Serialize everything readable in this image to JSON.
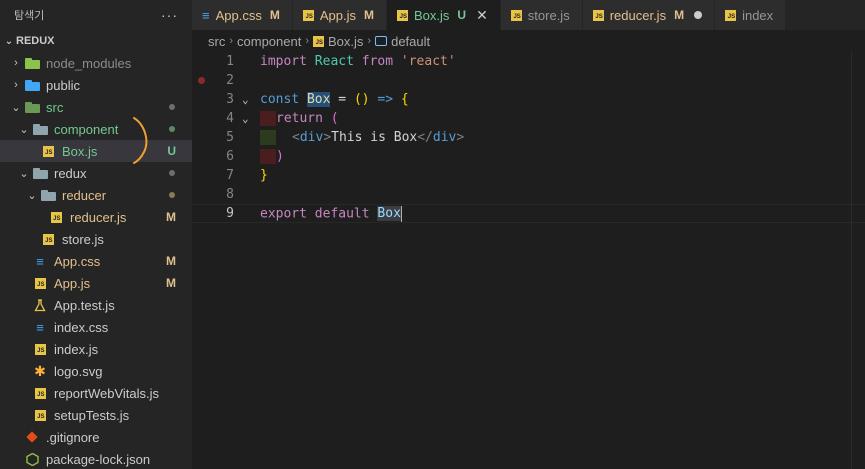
{
  "sidebar": {
    "title": "탐색기",
    "more_label": "···",
    "workspace": "REDUX",
    "items": [
      {
        "label": "node_modules",
        "depth": 1,
        "kind": "folder",
        "icon": "node-modules-folder-icon",
        "chev": "›",
        "status": "",
        "color": "dim"
      },
      {
        "label": "public",
        "depth": 1,
        "kind": "folder",
        "icon": "public-folder-icon",
        "chev": "›",
        "status": "",
        "color": ""
      },
      {
        "label": "src",
        "depth": 1,
        "kind": "folder-open",
        "icon": "src-folder-icon",
        "chev": "⌄",
        "status": "dot",
        "color": "untracked"
      },
      {
        "label": "component",
        "depth": 2,
        "kind": "folder-open",
        "icon": "folder-icon",
        "chev": "⌄",
        "status": "dot-green",
        "color": "untracked"
      },
      {
        "label": "Box.js",
        "depth": 3,
        "kind": "js",
        "icon": "js-file-icon",
        "chev": "",
        "status": "U",
        "color": "untracked",
        "selected": true
      },
      {
        "label": "redux",
        "depth": 2,
        "kind": "folder-open",
        "icon": "folder-icon",
        "chev": "⌄",
        "status": "dot",
        "color": ""
      },
      {
        "label": "reducer",
        "depth": 3,
        "kind": "folder-open",
        "icon": "folder-icon",
        "chev": "⌄",
        "status": "dot-yellow",
        "color": "mod"
      },
      {
        "label": "reducer.js",
        "depth": 4,
        "kind": "js",
        "icon": "js-file-icon",
        "chev": "",
        "status": "M",
        "color": "mod"
      },
      {
        "label": "store.js",
        "depth": 3,
        "kind": "js",
        "icon": "js-file-icon",
        "chev": "",
        "status": "",
        "color": ""
      },
      {
        "label": "App.css",
        "depth": 2,
        "kind": "css",
        "icon": "css-file-icon",
        "chev": "",
        "status": "M",
        "color": "mod"
      },
      {
        "label": "App.js",
        "depth": 2,
        "kind": "js",
        "icon": "js-file-icon",
        "chev": "",
        "status": "M",
        "color": "mod"
      },
      {
        "label": "App.test.js",
        "depth": 2,
        "kind": "test",
        "icon": "test-file-icon",
        "chev": "",
        "status": "",
        "color": ""
      },
      {
        "label": "index.css",
        "depth": 2,
        "kind": "css",
        "icon": "css-file-icon",
        "chev": "",
        "status": "",
        "color": ""
      },
      {
        "label": "index.js",
        "depth": 2,
        "kind": "js",
        "icon": "js-file-icon",
        "chev": "",
        "status": "",
        "color": ""
      },
      {
        "label": "logo.svg",
        "depth": 2,
        "kind": "svg",
        "icon": "svg-file-icon",
        "chev": "",
        "status": "",
        "color": ""
      },
      {
        "label": "reportWebVitals.js",
        "depth": 2,
        "kind": "js",
        "icon": "js-file-icon",
        "chev": "",
        "status": "",
        "color": ""
      },
      {
        "label": "setupTests.js",
        "depth": 2,
        "kind": "js",
        "icon": "js-file-icon",
        "chev": "",
        "status": "",
        "color": ""
      },
      {
        "label": ".gitignore",
        "depth": 1,
        "kind": "git",
        "icon": "git-file-icon",
        "chev": "",
        "status": "",
        "color": ""
      },
      {
        "label": "package-lock.json",
        "depth": 1,
        "kind": "json",
        "icon": "json-file-icon",
        "chev": "",
        "status": "",
        "color": ""
      }
    ]
  },
  "tabs": [
    {
      "label": "App.css",
      "status": "M",
      "kind": "css",
      "active": false,
      "color": "mod"
    },
    {
      "label": "App.js",
      "status": "M",
      "kind": "js",
      "active": false,
      "color": "mod"
    },
    {
      "label": "Box.js",
      "status": "U",
      "kind": "js",
      "active": true,
      "color": "untracked"
    },
    {
      "label": "store.js",
      "status": "",
      "kind": "js",
      "active": false,
      "color": ""
    },
    {
      "label": "reducer.js",
      "status": "M",
      "kind": "js",
      "active": false,
      "color": "mod",
      "dirty": true
    },
    {
      "label": "index",
      "status": "",
      "kind": "js",
      "active": false,
      "color": ""
    }
  ],
  "breadcrumb": {
    "parts": [
      "src",
      "component",
      "Box.js",
      "default"
    ],
    "separator": "›"
  },
  "editor": {
    "lines": [
      "1",
      "2",
      "3",
      "4",
      "5",
      "6",
      "7",
      "8",
      "9"
    ],
    "code": {
      "import_kw": "import",
      "react_id": "React",
      "from_kw": "from",
      "react_str": "'react'",
      "const_kw": "const",
      "box_id": "Box",
      "eq": " = ",
      "parens": "()",
      "arrow": " => ",
      "open_brace": "{",
      "return_kw": "return",
      "open_paren": " (",
      "tag_open_lt": "<",
      "tag_name": "div",
      "tag_open_gt": ">",
      "jsx_text": "This is Box",
      "tag_close_lt": "</",
      "close_paren": ")",
      "close_brace": "}",
      "export_kw": "export",
      "default_kw": "default",
      "export_box": "Box"
    }
  },
  "colors": {
    "accent_orange": "#f0a030",
    "untracked_green": "#73c991",
    "modified_yellow": "#e2c08d"
  }
}
